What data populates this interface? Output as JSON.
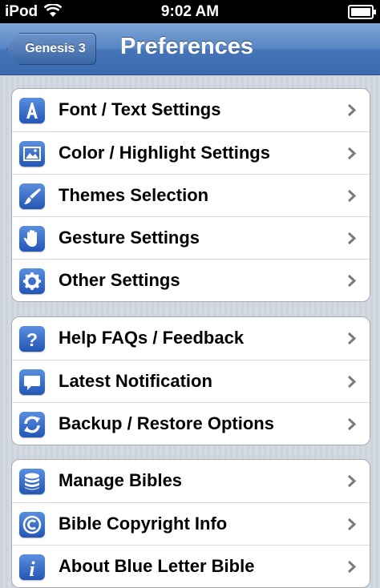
{
  "status": {
    "carrier": "iPod",
    "time": "9:02 AM"
  },
  "nav": {
    "back_label": "Genesis 3",
    "title": "Preferences"
  },
  "groups": [
    {
      "items": [
        {
          "label": "Font / Text Settings",
          "icon": "letter-a-icon"
        },
        {
          "label": "Color / Highlight Settings",
          "icon": "picture-icon"
        },
        {
          "label": "Themes Selection",
          "icon": "brush-icon"
        },
        {
          "label": "Gesture Settings",
          "icon": "hand-icon"
        },
        {
          "label": "Other Settings",
          "icon": "gear-icon"
        }
      ]
    },
    {
      "items": [
        {
          "label": "Help FAQs / Feedback",
          "icon": "question-icon"
        },
        {
          "label": "Latest Notification",
          "icon": "speech-bubble-icon"
        },
        {
          "label": "Backup / Restore Options",
          "icon": "sync-icon"
        }
      ]
    },
    {
      "items": [
        {
          "label": "Manage Bibles",
          "icon": "database-icon"
        },
        {
          "label": "Bible Copyright Info",
          "icon": "copyright-icon"
        },
        {
          "label": "About Blue Letter Bible",
          "icon": "info-icon"
        }
      ]
    }
  ],
  "colors": {
    "accent": "#3d6bb0",
    "icon_blue": "#2456b5"
  }
}
